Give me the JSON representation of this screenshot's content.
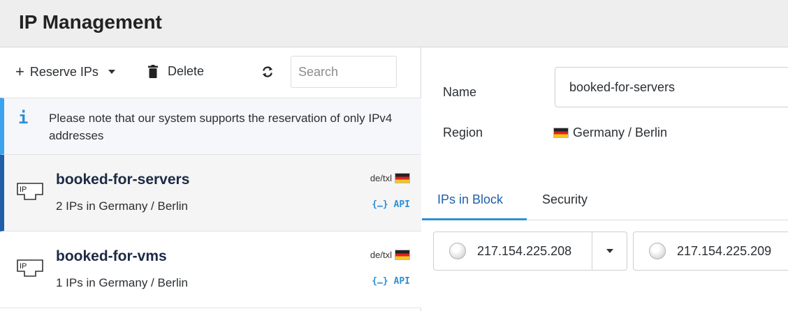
{
  "header": {
    "title": "IP Management"
  },
  "toolbar": {
    "reserve_label": "Reserve IPs",
    "delete_label": "Delete",
    "search_placeholder": "Search"
  },
  "notice": {
    "icon": "info-icon",
    "glyph": "i",
    "text": "Please note that our system supports the reservation of only IPv4 addresses"
  },
  "list": {
    "items": [
      {
        "name": "booked-for-servers",
        "subtitle": "2 IPs in Germany / Berlin",
        "location_code": "de/txl",
        "api_label": "{…} API",
        "selected": true
      },
      {
        "name": "booked-for-vms",
        "subtitle": "1 IPs in Germany / Berlin",
        "location_code": "de/txl",
        "api_label": "{…} API",
        "selected": false
      }
    ]
  },
  "details": {
    "name_label": "Name",
    "name_value": "booked-for-servers",
    "region_label": "Region",
    "region_value": "Germany / Berlin",
    "tabs": [
      {
        "label": "IPs in Block",
        "active": true
      },
      {
        "label": "Security",
        "active": false
      }
    ],
    "ips": [
      "217.154.225.208",
      "217.154.225.209"
    ]
  }
}
